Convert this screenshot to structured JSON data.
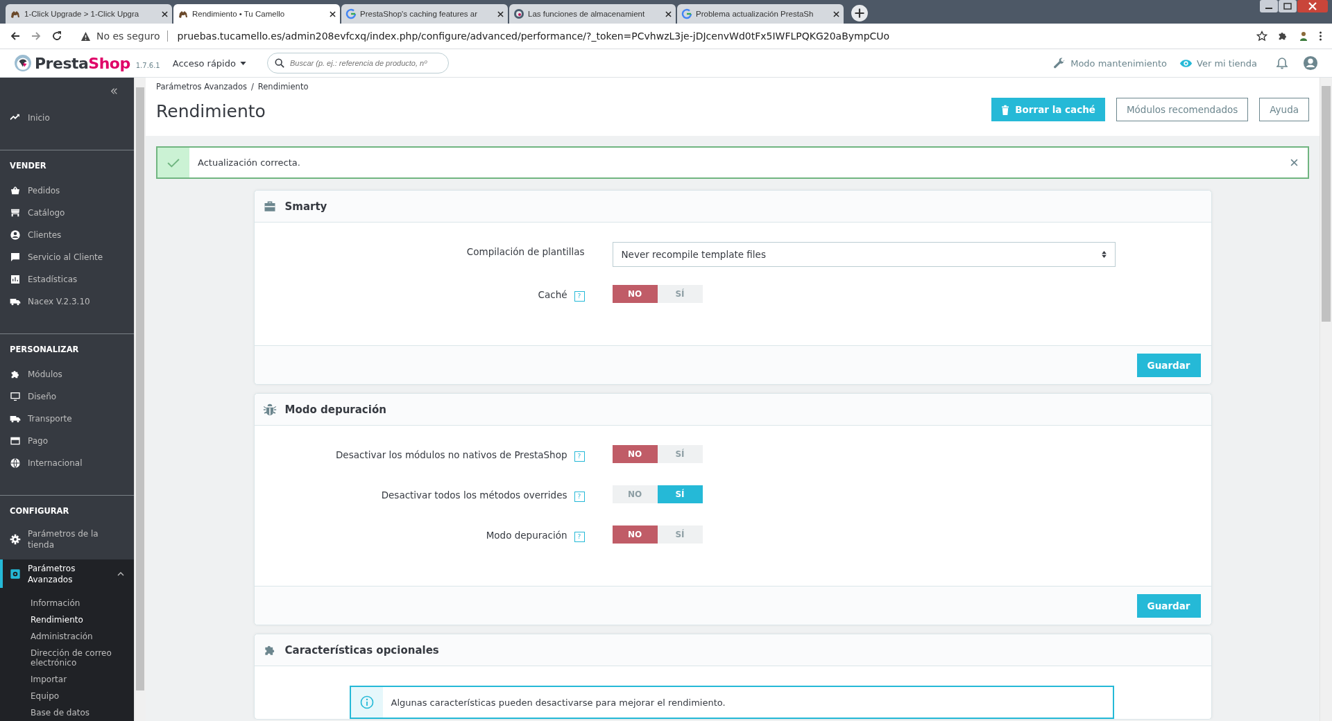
{
  "browser": {
    "tabs": [
      {
        "title": "1-Click Upgrade > 1-Click Upgra",
        "selected": false
      },
      {
        "title": "Rendimiento • Tu Camello",
        "selected": true
      },
      {
        "title": "PrestaShop's caching features ar",
        "selected": false
      },
      {
        "title": "Las funciones de almacenamient",
        "selected": false
      },
      {
        "title": "Problema actualización PrestaSh",
        "selected": false
      }
    ],
    "security_label": "No es seguro",
    "url": "pruebas.tucamello.es/admin208evfcxq/index.php/configure/advanced/performance/?_token=PCvhwzL3je-jDJcenvWd0tFx5IWFLPQKG20aBympCUo"
  },
  "header": {
    "logo": [
      "Presta",
      "Shop"
    ],
    "version": "1.7.6.1",
    "quick_access": "Acceso rápido",
    "search": {
      "placeholder": "Buscar (p. ej.: referencia de producto, nº"
    },
    "maintenance": "Modo mantenimiento",
    "view_store": "Ver mi tienda"
  },
  "sidebar": {
    "home": {
      "label": "Inicio",
      "selected": false
    },
    "sections": [
      {
        "title": "VENDER",
        "items": [
          {
            "label": "Pedidos",
            "selected": false
          },
          {
            "label": "Catálogo",
            "selected": false
          },
          {
            "label": "Clientes",
            "selected": false
          },
          {
            "label": "Servicio al Cliente",
            "selected": false
          },
          {
            "label": "Estadísticas",
            "selected": false
          },
          {
            "label": "Nacex V.2.3.10",
            "selected": false
          }
        ]
      },
      {
        "title": "PERSONALIZAR",
        "items": [
          {
            "label": "Módulos",
            "selected": false
          },
          {
            "label": "Diseño",
            "selected": false
          },
          {
            "label": "Transporte",
            "selected": false
          },
          {
            "label": "Pago",
            "selected": false
          },
          {
            "label": "Internacional",
            "selected": false
          }
        ]
      },
      {
        "title": "CONFIGURAR",
        "items": [
          {
            "label": "Parámetros de la tienda",
            "selected": false
          },
          {
            "label": "Parámetros Avanzados",
            "selected": true,
            "expanded": true,
            "children": [
              {
                "label": "Información",
                "selected": false
              },
              {
                "label": "Rendimiento",
                "selected": true
              },
              {
                "label": "Administración",
                "selected": false
              },
              {
                "label": "Dirección de correo electrónico",
                "selected": false
              },
              {
                "label": "Importar",
                "selected": false
              },
              {
                "label": "Equipo",
                "selected": false
              },
              {
                "label": "Base de datos",
                "selected": false
              }
            ]
          }
        ]
      }
    ]
  },
  "page": {
    "breadcrumb": [
      "Parámetros Avanzados",
      "Rendimiento"
    ],
    "breadcrumb_separator": "/",
    "title": "Rendimiento",
    "toolbar": [
      {
        "label": "Borrar la caché",
        "kind": "primary"
      },
      {
        "label": "Módulos recomendados",
        "kind": "outline"
      },
      {
        "label": "Ayuda",
        "kind": "outline"
      }
    ]
  },
  "alert": {
    "text": "Actualización correcta."
  },
  "panels": [
    {
      "title": "Smarty",
      "fields": [
        {
          "kind": "select",
          "label": "Compilación de plantillas",
          "value": "Never recompile template files"
        },
        {
          "kind": "switch",
          "label": "Caché",
          "help": "?",
          "options": [
            {
              "label": "NO",
              "selected": true
            },
            {
              "label": "SÍ",
              "selected": false
            }
          ]
        }
      ],
      "save": "Guardar"
    },
    {
      "title": "Modo depuración",
      "fields": [
        {
          "kind": "switch",
          "label": "Desactivar los módulos no nativos de PrestaShop",
          "help": "?",
          "options": [
            {
              "label": "NO",
              "selected": true
            },
            {
              "label": "SÍ",
              "selected": false
            }
          ]
        },
        {
          "kind": "switch",
          "label": "Desactivar todos los métodos overrides",
          "help": "?",
          "options": [
            {
              "label": "NO",
              "selected": false
            },
            {
              "label": "SÍ",
              "selected": true
            }
          ]
        },
        {
          "kind": "switch",
          "label": "Modo depuración",
          "help": "?",
          "options": [
            {
              "label": "NO",
              "selected": true
            },
            {
              "label": "SÍ",
              "selected": false
            }
          ]
        }
      ],
      "save": "Guardar"
    },
    {
      "title": "Características opcionales",
      "info": "Algunas características pueden desactivarse para mejorar el rendimiento."
    }
  ]
}
